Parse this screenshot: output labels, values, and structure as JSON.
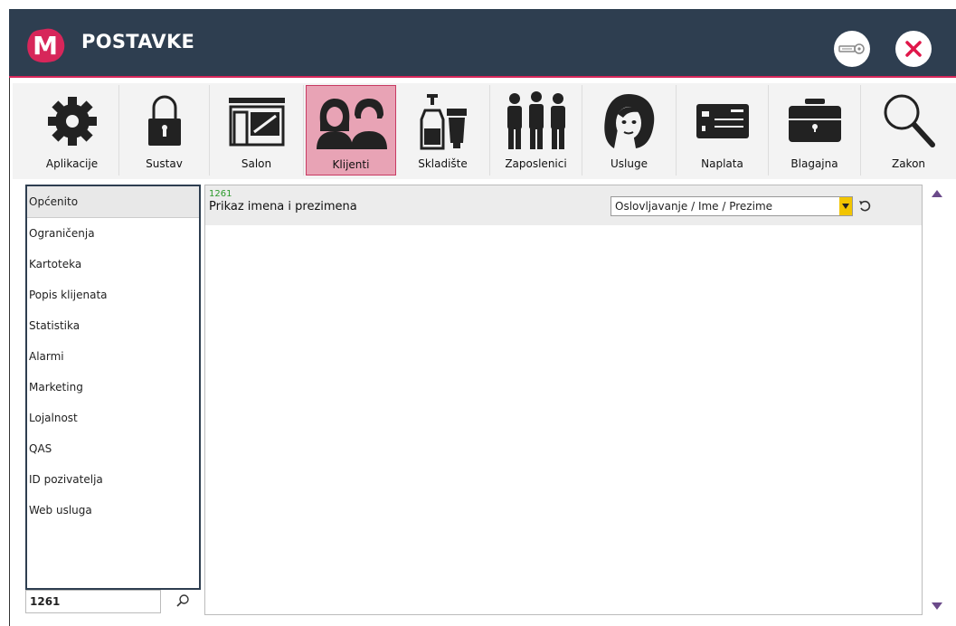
{
  "window": {
    "logo_letter": "M",
    "title": "POSTAVKE",
    "brand_color": "#d7265a",
    "header_color": "#2e3e50"
  },
  "toolbar": {
    "items": [
      {
        "label": "Aplikacije",
        "icon": "gear-icon"
      },
      {
        "label": "Sustav",
        "icon": "lock-icon"
      },
      {
        "label": "Salon",
        "icon": "storefront-icon"
      },
      {
        "label": "Klijenti",
        "icon": "clients-icon",
        "active": true
      },
      {
        "label": "Skladište",
        "icon": "products-icon"
      },
      {
        "label": "Zaposlenici",
        "icon": "employees-icon"
      },
      {
        "label": "Usluge",
        "icon": "woman-face-icon"
      },
      {
        "label": "Naplata",
        "icon": "payment-card-icon"
      },
      {
        "label": "Blagajna",
        "icon": "cash-register-icon"
      },
      {
        "label": "Zakon",
        "icon": "magnifier-icon"
      }
    ]
  },
  "sidebar": {
    "items": [
      {
        "label": "Općenito",
        "selected": true
      },
      {
        "label": "Ograničenja"
      },
      {
        "label": "Kartoteka"
      },
      {
        "label": "Popis klijenata"
      },
      {
        "label": "Statistika"
      },
      {
        "label": "Alarmi"
      },
      {
        "label": "Marketing"
      },
      {
        "label": "Lojalnost"
      },
      {
        "label": "QAS"
      },
      {
        "label": "ID pozivatelja"
      },
      {
        "label": "Web usluga"
      }
    ],
    "search_value": "1261"
  },
  "setting": {
    "code": "1261",
    "label": "Prikaz imena i prezimena",
    "value": "Oslovljavanje / Ime / Prezime"
  }
}
